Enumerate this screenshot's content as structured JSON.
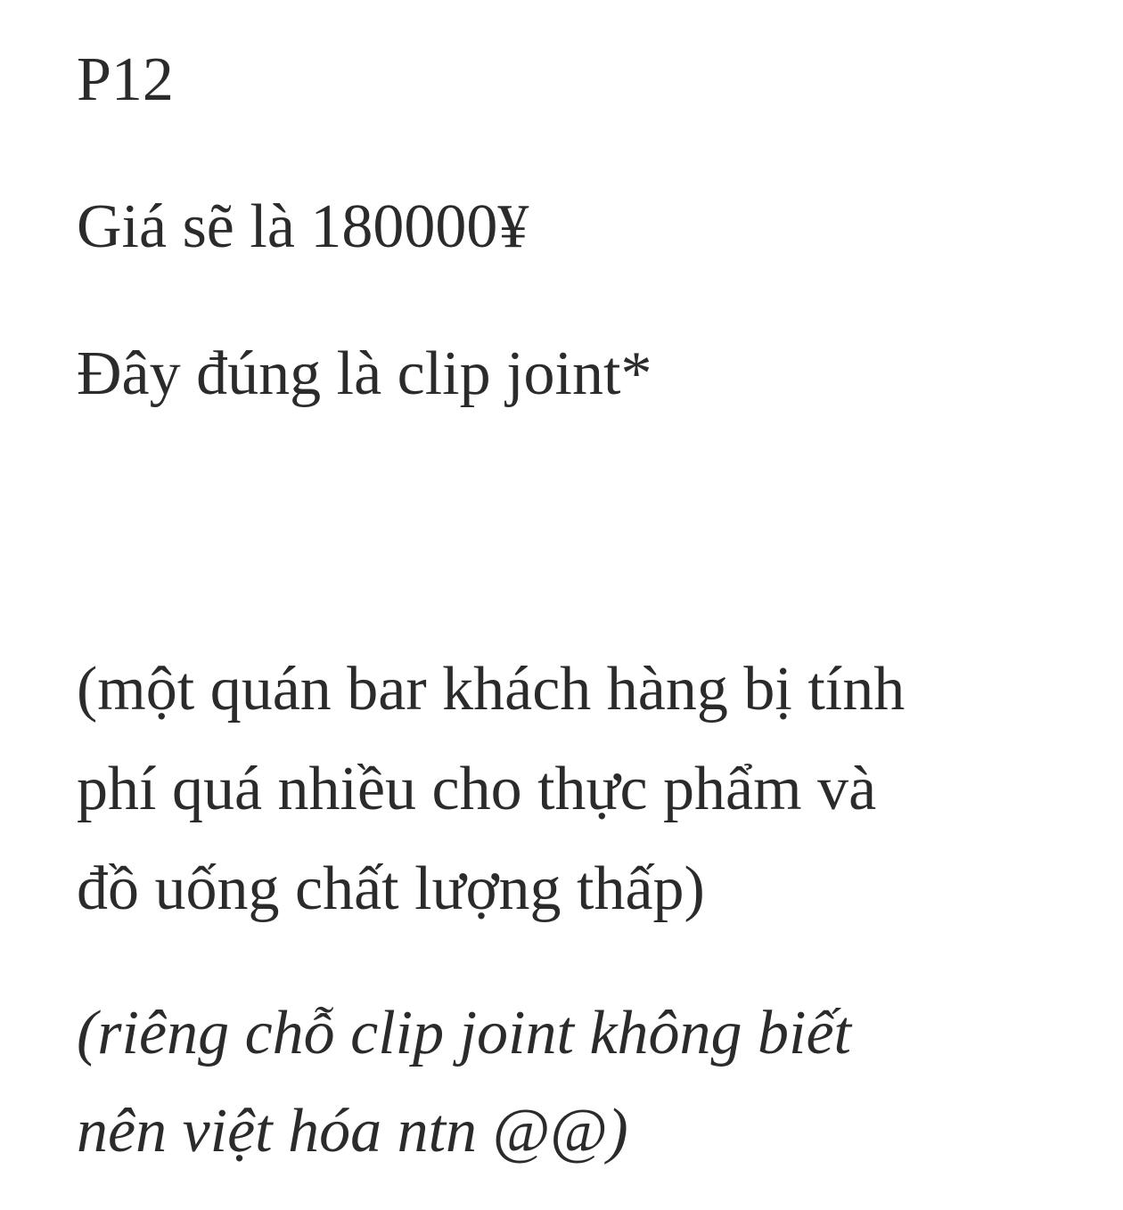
{
  "document": {
    "page_label": "P12",
    "price_line": "Giá sẽ là 180000¥",
    "statement_line": "Đây đúng là clip joint*",
    "explanation_lines": [
      "(một quán bar  khách hàng bị tính",
      "phí quá nhiều cho thực phẩm và",
      "đồ uống chất lượng thấp)"
    ],
    "translator_note_lines": [
      "(riêng chỗ clip joint không biết",
      "nên việt hóa ntn @@)"
    ]
  },
  "colors": {
    "background": "#ffffff",
    "text": "#2b2b2b"
  }
}
